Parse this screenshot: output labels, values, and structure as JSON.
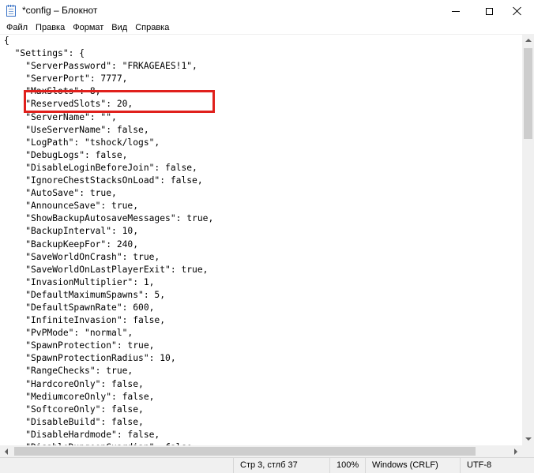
{
  "window": {
    "title": "*config – Блокнот",
    "icon": "notepad-icon"
  },
  "menu": [
    {
      "label": "Файл"
    },
    {
      "label": "Правка"
    },
    {
      "label": "Формат"
    },
    {
      "label": "Вид"
    },
    {
      "label": "Справка"
    }
  ],
  "editor": {
    "lines": [
      "{",
      "  \"Settings\": {",
      "    \"ServerPassword\": \"FRKAGEAES!1\",",
      "    \"ServerPort\": 7777,",
      "    \"MaxSlots\": 8,",
      "    \"ReservedSlots\": 20,",
      "    \"ServerName\": \"\",",
      "    \"UseServerName\": false,",
      "    \"LogPath\": \"tshock/logs\",",
      "    \"DebugLogs\": false,",
      "    \"DisableLoginBeforeJoin\": false,",
      "    \"IgnoreChestStacksOnLoad\": false,",
      "    \"AutoSave\": true,",
      "    \"AnnounceSave\": true,",
      "    \"ShowBackupAutosaveMessages\": true,",
      "    \"BackupInterval\": 10,",
      "    \"BackupKeepFor\": 240,",
      "    \"SaveWorldOnCrash\": true,",
      "    \"SaveWorldOnLastPlayerExit\": true,",
      "    \"InvasionMultiplier\": 1,",
      "    \"DefaultMaximumSpawns\": 5,",
      "    \"DefaultSpawnRate\": 600,",
      "    \"InfiniteInvasion\": false,",
      "    \"PvPMode\": \"normal\",",
      "    \"SpawnProtection\": true,",
      "    \"SpawnProtectionRadius\": 10,",
      "    \"RangeChecks\": true,",
      "    \"HardcoreOnly\": false,",
      "    \"MediumcoreOnly\": false,",
      "    \"SoftcoreOnly\": false,",
      "    \"DisableBuild\": false,",
      "    \"DisableHardmode\": false,",
      "    \"DisableDungeonGuardian\": false,"
    ],
    "highlight_color": "#e0201c"
  },
  "status": {
    "position": "Стр 3, стлб 37",
    "zoom": "100%",
    "line_endings": "Windows (CRLF)",
    "encoding": "UTF-8"
  },
  "colors": {
    "background": "#ffffff",
    "chrome": "#f0f0f0",
    "scroll_thumb": "#cdcdcd"
  }
}
